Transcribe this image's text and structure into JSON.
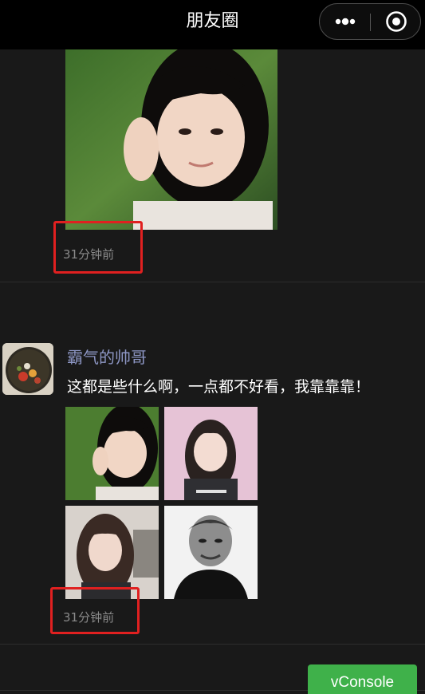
{
  "nav": {
    "title": "朋友圈"
  },
  "posts": [
    {
      "images": [
        "girl-photo"
      ],
      "time": "31分钟前"
    },
    {
      "username": "霸气的帅哥",
      "text": "这都是些什么啊，一点都不好看，我靠靠靠！",
      "images": [
        "girl-photo",
        "girl-pink-bg-photo",
        "girl-long-hair-photo",
        "man-portrait-photo"
      ],
      "time": "31分钟前"
    }
  ],
  "vconsole": {
    "label": "vConsole"
  },
  "colors": {
    "background": "#191919",
    "nav_bar": "#000000",
    "username": "#8d96c4",
    "timestamp": "#8a8a8a",
    "highlight_box": "#e02020",
    "vconsole_button": "#3fb14a"
  }
}
